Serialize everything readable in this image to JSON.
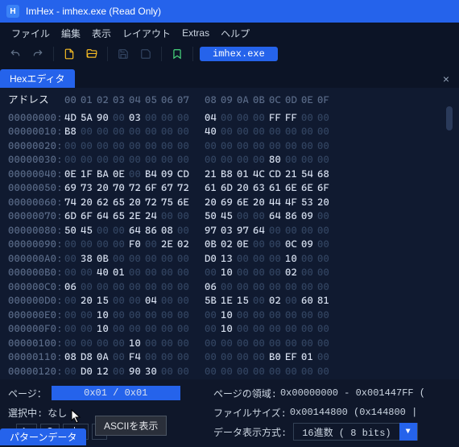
{
  "title": "ImHex - imhex.exe (Read Only)",
  "menu": {
    "file": "ファイル",
    "edit": "編集",
    "view": "表示",
    "layout": "レイアウト",
    "extras": "Extras",
    "help": "ヘルプ"
  },
  "file_tab": "imhex.exe",
  "main_tab": "Hexエディタ",
  "hex": {
    "addr_label": "アドレス",
    "cols": [
      "00",
      "01",
      "02",
      "03",
      "04",
      "05",
      "06",
      "07",
      "08",
      "09",
      "0A",
      "0B",
      "0C",
      "0D",
      "0E",
      "0F"
    ],
    "rows": [
      {
        "addr": "00000000:",
        "b": [
          "4D",
          "5A",
          "90",
          "00",
          "03",
          "00",
          "00",
          "00",
          "04",
          "00",
          "00",
          "00",
          "FF",
          "FF",
          "00",
          "00"
        ]
      },
      {
        "addr": "00000010:",
        "b": [
          "B8",
          "00",
          "00",
          "00",
          "00",
          "00",
          "00",
          "00",
          "40",
          "00",
          "00",
          "00",
          "00",
          "00",
          "00",
          "00"
        ]
      },
      {
        "addr": "00000020:",
        "b": [
          "00",
          "00",
          "00",
          "00",
          "00",
          "00",
          "00",
          "00",
          "00",
          "00",
          "00",
          "00",
          "00",
          "00",
          "00",
          "00"
        ]
      },
      {
        "addr": "00000030:",
        "b": [
          "00",
          "00",
          "00",
          "00",
          "00",
          "00",
          "00",
          "00",
          "00",
          "00",
          "00",
          "00",
          "80",
          "00",
          "00",
          "00"
        ]
      },
      {
        "addr": "00000040:",
        "b": [
          "0E",
          "1F",
          "BA",
          "0E",
          "00",
          "B4",
          "09",
          "CD",
          "21",
          "B8",
          "01",
          "4C",
          "CD",
          "21",
          "54",
          "68"
        ]
      },
      {
        "addr": "00000050:",
        "b": [
          "69",
          "73",
          "20",
          "70",
          "72",
          "6F",
          "67",
          "72",
          "61",
          "6D",
          "20",
          "63",
          "61",
          "6E",
          "6E",
          "6F"
        ]
      },
      {
        "addr": "00000060:",
        "b": [
          "74",
          "20",
          "62",
          "65",
          "20",
          "72",
          "75",
          "6E",
          "20",
          "69",
          "6E",
          "20",
          "44",
          "4F",
          "53",
          "20"
        ]
      },
      {
        "addr": "00000070:",
        "b": [
          "6D",
          "6F",
          "64",
          "65",
          "2E",
          "24",
          "00",
          "00",
          "50",
          "45",
          "00",
          "00",
          "64",
          "86",
          "09",
          "00"
        ]
      },
      {
        "addr": "00000080:",
        "b": [
          "50",
          "45",
          "00",
          "00",
          "64",
          "86",
          "08",
          "00",
          "97",
          "03",
          "97",
          "64",
          "00",
          "00",
          "00",
          "00"
        ]
      },
      {
        "addr": "00000090:",
        "b": [
          "00",
          "00",
          "00",
          "00",
          "F0",
          "00",
          "2E",
          "02",
          "0B",
          "02",
          "0E",
          "00",
          "00",
          "0C",
          "09",
          "00"
        ]
      },
      {
        "addr": "000000A0:",
        "b": [
          "00",
          "38",
          "0B",
          "00",
          "00",
          "00",
          "00",
          "00",
          "D0",
          "13",
          "00",
          "00",
          "00",
          "10",
          "00",
          "00"
        ]
      },
      {
        "addr": "000000B0:",
        "b": [
          "00",
          "00",
          "40",
          "01",
          "00",
          "00",
          "00",
          "00",
          "00",
          "10",
          "00",
          "00",
          "00",
          "02",
          "00",
          "00"
        ]
      },
      {
        "addr": "000000C0:",
        "b": [
          "06",
          "00",
          "00",
          "00",
          "00",
          "00",
          "00",
          "00",
          "06",
          "00",
          "00",
          "00",
          "00",
          "00",
          "00",
          "00"
        ]
      },
      {
        "addr": "000000D0:",
        "b": [
          "00",
          "20",
          "15",
          "00",
          "00",
          "04",
          "00",
          "00",
          "5B",
          "1E",
          "15",
          "00",
          "02",
          "00",
          "60",
          "81"
        ]
      },
      {
        "addr": "000000E0:",
        "b": [
          "00",
          "00",
          "10",
          "00",
          "00",
          "00",
          "00",
          "00",
          "00",
          "10",
          "00",
          "00",
          "00",
          "00",
          "00",
          "00"
        ]
      },
      {
        "addr": "000000F0:",
        "b": [
          "00",
          "00",
          "10",
          "00",
          "00",
          "00",
          "00",
          "00",
          "00",
          "10",
          "00",
          "00",
          "00",
          "00",
          "00",
          "00"
        ]
      },
      {
        "addr": "00000100:",
        "b": [
          "00",
          "00",
          "00",
          "00",
          "10",
          "00",
          "00",
          "00",
          "00",
          "00",
          "00",
          "00",
          "00",
          "00",
          "00",
          "00"
        ]
      },
      {
        "addr": "00000110:",
        "b": [
          "08",
          "D8",
          "0A",
          "00",
          "F4",
          "00",
          "00",
          "00",
          "00",
          "00",
          "00",
          "00",
          "B0",
          "EF",
          "01",
          "00"
        ]
      },
      {
        "addr": "00000120:",
        "b": [
          "00",
          "D0",
          "12",
          "00",
          "90",
          "30",
          "00",
          "00",
          "00",
          "00",
          "00",
          "00",
          "00",
          "00",
          "00",
          "00"
        ]
      }
    ]
  },
  "status": {
    "page_label": "ページ：",
    "page_value": "0x01 / 0x01",
    "sel_label": "選択中:",
    "sel_value": "なし",
    "region_label": "ページの領域:",
    "region_value": "0x00000000 - 0x001447FF (",
    "size_label": "ファイルサイズ:",
    "size_value": "0x00144800 (0x144800 |",
    "fmt_label": "データ表示方式:",
    "fmt_value": "16進数 ( 8 bits)"
  },
  "bottom_buttons": {
    "aa": "Aa",
    "abc": "abc"
  },
  "tooltip": "ASCIIを表示",
  "bottom_tab": "パターンデータ"
}
